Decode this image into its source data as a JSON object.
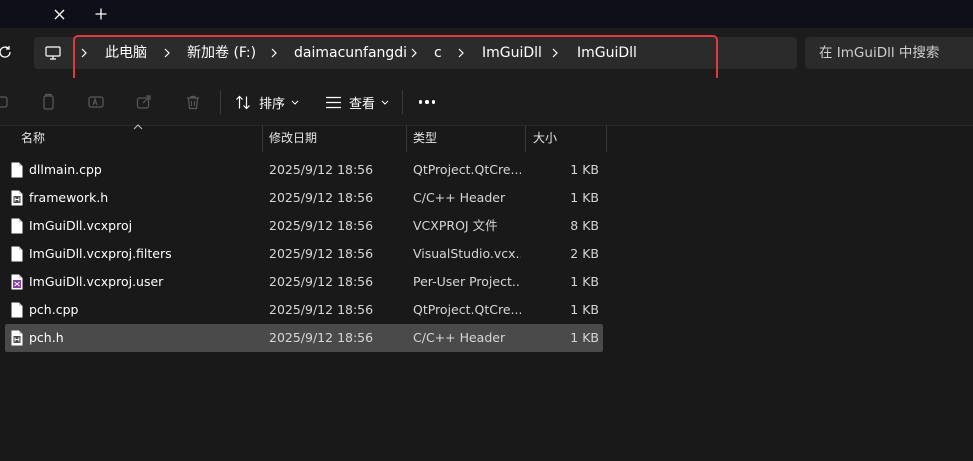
{
  "window": {
    "tab_close_icon": "close-icon",
    "new_tab_icon": "plus-icon"
  },
  "nav": {
    "refresh_icon": "refresh-icon",
    "pc_icon": "computer-icon",
    "breadcrumb": [
      "此电脑",
      "新加卷 (F:)",
      "daimacunfangdi",
      "c",
      "ImGuiDll",
      "ImGuiDll"
    ],
    "highlight_color": "#e0393e",
    "search_placeholder": "在 ImGuiDll 中搜索"
  },
  "toolbar": {
    "sort_label": "排序",
    "view_label": "查看",
    "more_icon": "more-icon"
  },
  "columns": {
    "name": "名称",
    "date": "修改日期",
    "type": "类型",
    "size": "大小"
  },
  "files": [
    {
      "name": "dllmain.cpp",
      "date": "2025/9/12 18:56",
      "type": "QtProject.QtCre...",
      "size": "1 KB",
      "icon": "file-icon"
    },
    {
      "name": "framework.h",
      "date": "2025/9/12 18:56",
      "type": "C/C++ Header",
      "size": "1 KB",
      "icon": "header-file-icon"
    },
    {
      "name": "ImGuiDll.vcxproj",
      "date": "2025/9/12 18:56",
      "type": "VCXPROJ 文件",
      "size": "8 KB",
      "icon": "file-icon"
    },
    {
      "name": "ImGuiDll.vcxproj.filters",
      "date": "2025/9/12 18:56",
      "type": "VisualStudio.vcx...",
      "size": "2 KB",
      "icon": "file-icon"
    },
    {
      "name": "ImGuiDll.vcxproj.user",
      "date": "2025/9/12 18:56",
      "type": "Per-User Project...",
      "size": "1 KB",
      "icon": "project-user-file-icon"
    },
    {
      "name": "pch.cpp",
      "date": "2025/9/12 18:56",
      "type": "QtProject.QtCre...",
      "size": "1 KB",
      "icon": "file-icon"
    },
    {
      "name": "pch.h",
      "date": "2025/9/12 18:56",
      "type": "C/C++ Header",
      "size": "1 KB",
      "icon": "header-file-icon",
      "selected": true
    }
  ]
}
